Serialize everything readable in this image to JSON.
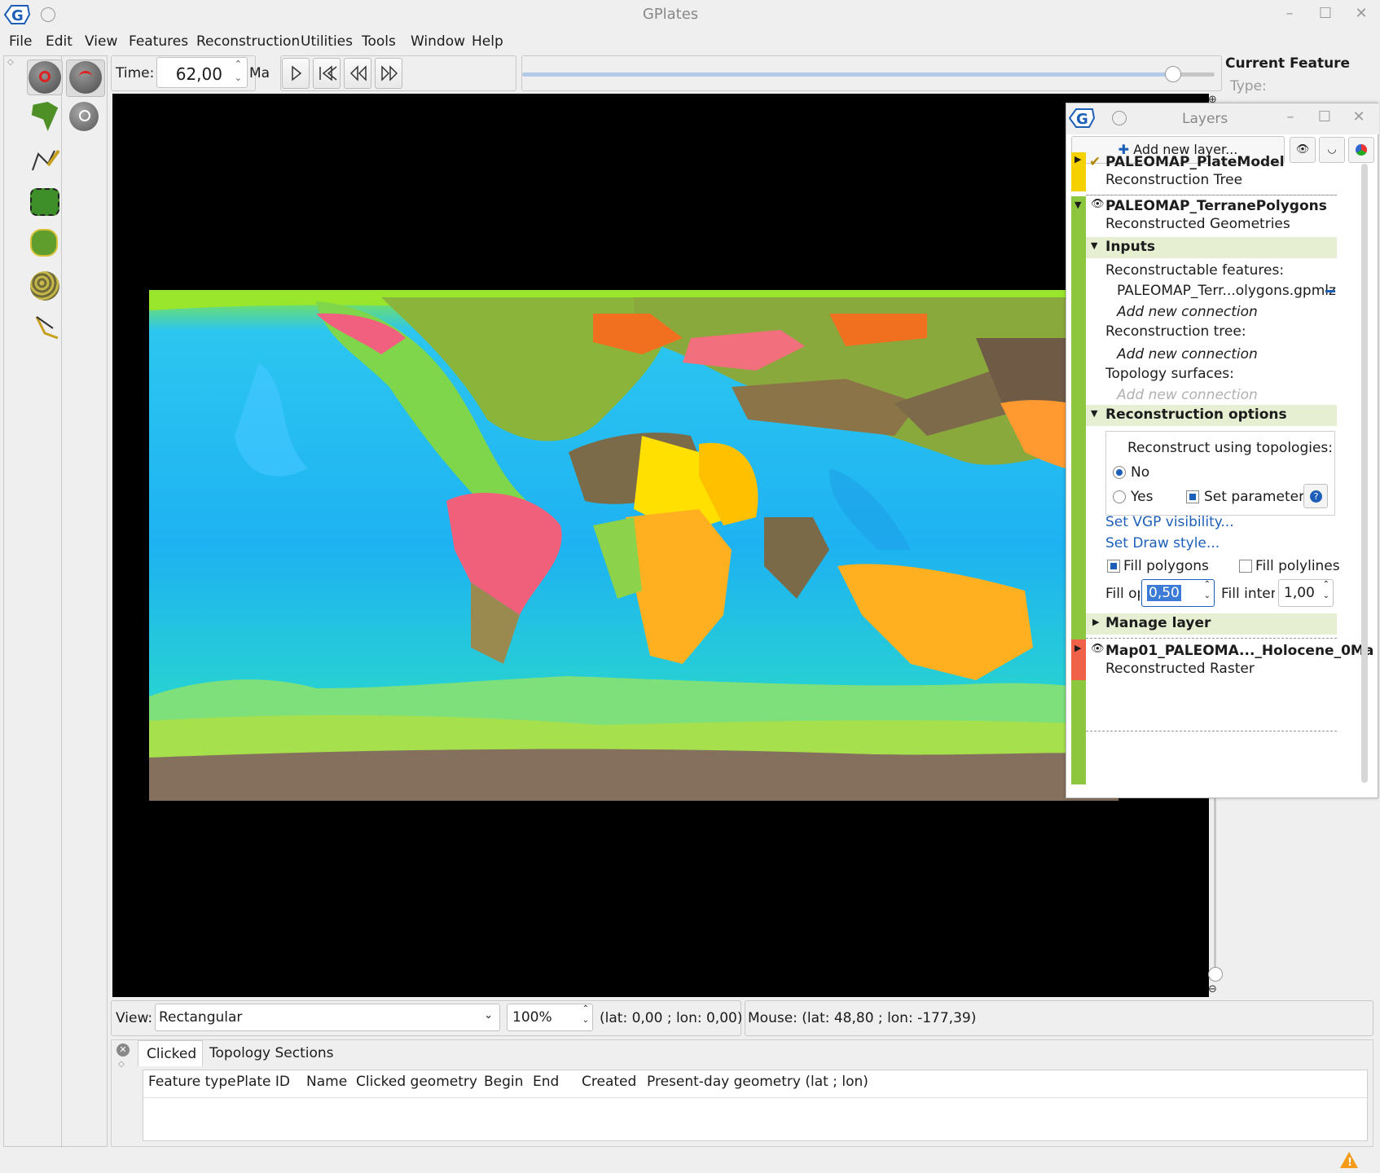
{
  "app": {
    "title": "GPlates"
  },
  "menu": [
    "File",
    "Edit",
    "View",
    "Features",
    "Reconstruction",
    "Utilities",
    "Tools",
    "Window",
    "Help"
  ],
  "time": {
    "label": "Time:",
    "value": "62,00",
    "unit": "Ma",
    "slider_fraction": 0.94
  },
  "current_feature": {
    "title": "Current Feature",
    "type_label": "Type:"
  },
  "layers": {
    "title": "Layers",
    "add_label": "Add new layer...",
    "items": [
      {
        "name": "PALEOMAP_PlateModel",
        "type": "Reconstruction Tree",
        "color": "#f6d100"
      },
      {
        "name": "PALEOMAP_TerranePolygons",
        "type": "Reconstructed Geometries",
        "color": "#8dc63f"
      },
      {
        "name": "Map01_PALEOMA..._Holocene_0Ma",
        "type": "Reconstructed Raster",
        "color": "#f0614a"
      }
    ],
    "inputs": {
      "header": "Inputs",
      "features_label": "Reconstructable features:",
      "feature_file": "PALEOMAP_Terr...olygons.gpmlz",
      "add_connection": "Add new connection",
      "tree_label": "Reconstruction tree:",
      "topology_label": "Topology surfaces:"
    },
    "options": {
      "header": "Reconstruction options",
      "group_label": "Reconstruct using topologies:",
      "no": "No",
      "yes": "Yes",
      "set_params": "Set parameters",
      "vgp": "Set VGP visibility...",
      "draw": "Set Draw style...",
      "fill_polygons": "Fill polygons",
      "fill_polylines": "Fill polylines",
      "fill_opacity_label": "Fill opaci",
      "fill_opacity": "0,50",
      "fill_intensity_label": "Fill inten:",
      "fill_intensity": "1,00"
    },
    "manage": "Manage layer"
  },
  "view": {
    "label": "View:",
    "projection": "Rectangular",
    "zoom": "100%",
    "center": "(lat: 0,00 ; lon: 0,00)",
    "mouse": "Mouse: (lat: 48,80 ; lon: -177,39)"
  },
  "panel": {
    "tabs": [
      "Clicked",
      "Topology Sections"
    ],
    "columns": [
      "Feature type",
      "Plate ID",
      "Name",
      "Clicked geometry",
      "Begin",
      "End",
      "Created",
      "Present-day geometry (lat ; lon)"
    ]
  }
}
